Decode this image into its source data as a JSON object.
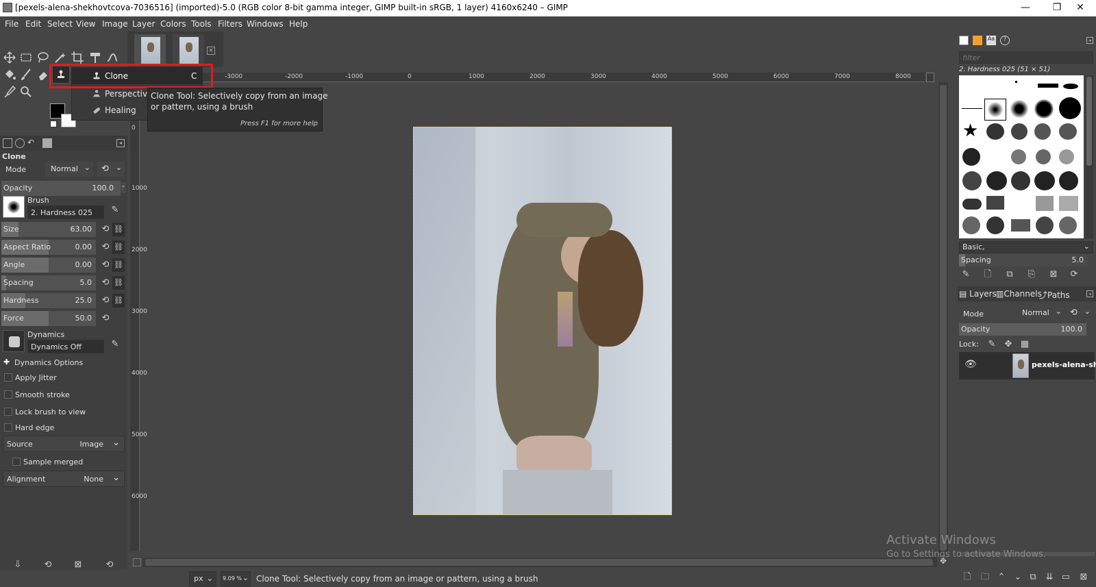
{
  "window": {
    "title": "[pexels-alena-shekhovtcova-7036516] (imported)-5.0 (RGB color 8-bit gamma integer, GIMP built-in sRGB, 1 layer) 4160x6240 – GIMP",
    "minimize": "—",
    "maximize": "❐",
    "close": "✕"
  },
  "menus": [
    "File",
    "Edit",
    "Select",
    "View",
    "Image",
    "Layer",
    "Colors",
    "Tools",
    "Filters",
    "Windows",
    "Help"
  ],
  "flyout": {
    "items": [
      {
        "label": "Clone",
        "shortcut": "C"
      },
      {
        "label": "Perspective"
      },
      {
        "label": "Healing"
      }
    ]
  },
  "tooltip": {
    "line1": "Clone Tool: Selectively copy from an image",
    "line2": "or pattern, using a brush",
    "hint": "Press F1 for more help"
  },
  "tool_options": {
    "title": "Clone",
    "mode_label": "Mode",
    "mode_value": "Normal",
    "opacity_label": "Opacity",
    "opacity_value": "100.0",
    "brush_label": "Brush",
    "brush_value": "2. Hardness 025",
    "sliders": [
      {
        "label": "Size",
        "value": "63.00",
        "fill": 0.18
      },
      {
        "label": "Aspect Ratio",
        "value": "0.00",
        "fill": 0.5
      },
      {
        "label": "Angle",
        "value": "0.00",
        "fill": 0.5
      },
      {
        "label": "Spacing",
        "value": "5.0",
        "fill": 0.05
      },
      {
        "label": "Hardness",
        "value": "25.0",
        "fill": 0.25
      },
      {
        "label": "Force",
        "value": "50.0",
        "fill": 0.5
      }
    ],
    "dynamics_label": "Dynamics",
    "dynamics_value": "Dynamics Off",
    "dynamics_options": "Dynamics Options",
    "checks": [
      "Apply Jitter",
      "Smooth stroke",
      "Lock brush to view",
      "Hard edge"
    ],
    "source_label": "Source",
    "source_value": "Image",
    "sample_merged": "Sample merged",
    "alignment_label": "Alignment",
    "alignment_value": "None"
  },
  "rulers": {
    "h": [
      "-3000",
      "-2000",
      "-1000",
      "0",
      "1000",
      "2000",
      "3000",
      "4000",
      "5000",
      "6000",
      "7000",
      "8000"
    ],
    "v": [
      "0",
      "1000",
      "2000",
      "3000",
      "4000",
      "5000",
      "6000"
    ]
  },
  "statusbar": {
    "unit": "px",
    "zoom": "9.09 %",
    "message": "Clone Tool: Selectively copy from an image or pattern, using a brush"
  },
  "brushes": {
    "filter_placeholder": "filter",
    "selected": "2. Hardness 025 (51 × 51)",
    "preset": "Basic,",
    "spacing_label": "Spacing",
    "spacing_value": "5.0"
  },
  "layers": {
    "tabs": [
      "Layers",
      "Channels",
      "Paths"
    ],
    "mode_label": "Mode",
    "mode_value": "Normal",
    "opacity_label": "Opacity",
    "opacity_value": "100.0",
    "lock_label": "Lock:",
    "layer_name": "pexels-alena-sh"
  },
  "watermark": {
    "line1": "Activate Windows",
    "line2": "Go to Settings to activate Windows."
  },
  "colors": {
    "bg": "#454545",
    "panel": "#3c3c3c",
    "highlight": "#e01b22",
    "selected": "#2a2a2a"
  }
}
